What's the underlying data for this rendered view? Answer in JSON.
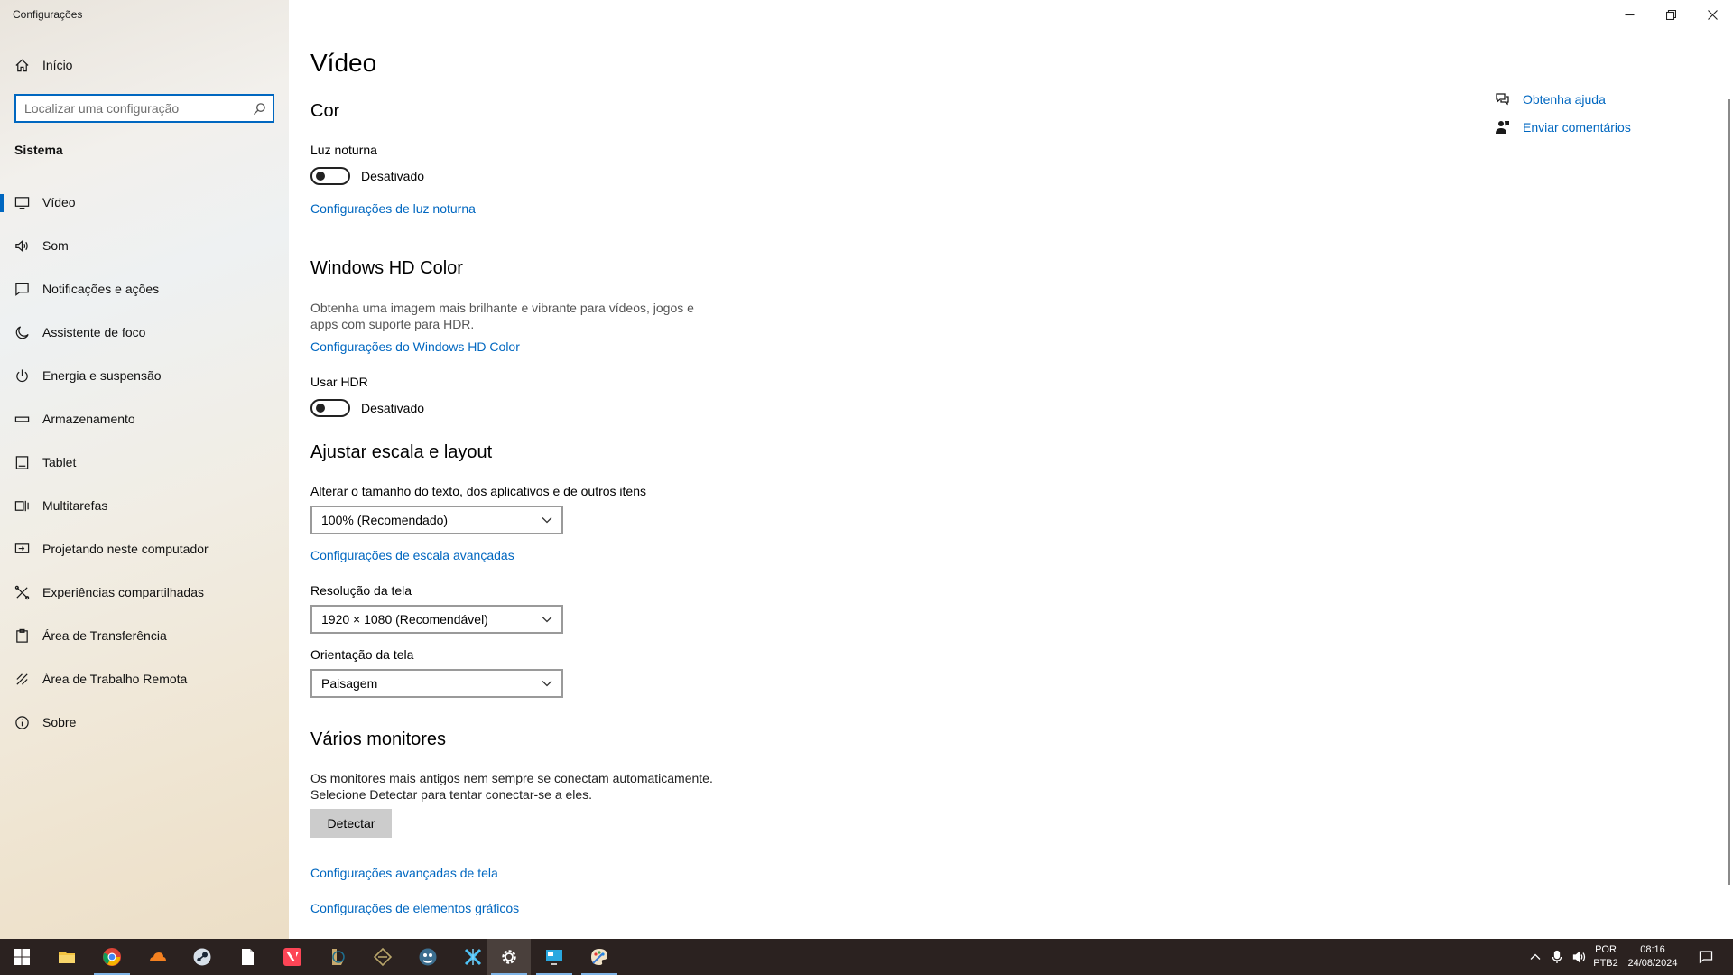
{
  "window": {
    "title": "Configurações",
    "controls": {
      "minimize": "minimize-icon",
      "restore": "restore-icon",
      "close": "close-icon"
    }
  },
  "sidebar": {
    "home_label": "Início",
    "search_placeholder": "Localizar uma configuração",
    "section_label": "Sistema",
    "items": [
      {
        "label": "Vídeo",
        "icon": "monitor-icon",
        "active": true
      },
      {
        "label": "Som",
        "icon": "speaker-icon"
      },
      {
        "label": "Notificações e ações",
        "icon": "notification-icon"
      },
      {
        "label": "Assistente de foco",
        "icon": "moon-icon"
      },
      {
        "label": "Energia e suspensão",
        "icon": "power-icon"
      },
      {
        "label": "Armazenamento",
        "icon": "storage-icon"
      },
      {
        "label": "Tablet",
        "icon": "tablet-icon"
      },
      {
        "label": "Multitarefas",
        "icon": "multitask-icon"
      },
      {
        "label": "Projetando neste computador",
        "icon": "project-icon"
      },
      {
        "label": "Experiências compartilhadas",
        "icon": "shared-icon"
      },
      {
        "label": "Área de Transferência",
        "icon": "clipboard-icon"
      },
      {
        "label": "Área de Trabalho Remota",
        "icon": "remote-icon"
      },
      {
        "label": "Sobre",
        "icon": "info-icon"
      }
    ]
  },
  "main": {
    "title": "Vídeo",
    "color": {
      "heading": "Cor",
      "night_light_label": "Luz noturna",
      "night_light_state": "Desativado",
      "night_light_link": "Configurações de luz noturna"
    },
    "hdr": {
      "heading": "Windows HD Color",
      "description_line1": "Obtenha uma imagem mais brilhante e vibrante para vídeos, jogos e",
      "description_line2": "apps com suporte para HDR.",
      "settings_link": "Configurações do Windows HD Color",
      "use_hdr_label": "Usar HDR",
      "use_hdr_state": "Desativado"
    },
    "scale": {
      "heading": "Ajustar escala e layout",
      "size_label": "Alterar o tamanho do texto, dos aplicativos e de outros itens",
      "size_value": "100% (Recomendado)",
      "advanced_link": "Configurações de escala avançadas",
      "resolution_label": "Resolução da tela",
      "resolution_value": "1920 × 1080 (Recomendável)",
      "orientation_label": "Orientação da tela",
      "orientation_value": "Paisagem"
    },
    "monitors": {
      "heading": "Vários monitores",
      "description_line1": "Os monitores mais antigos nem sempre se conectam automaticamente.",
      "description_line2": "Selecione Detectar para tentar conectar-se a eles.",
      "detect_button": "Detectar",
      "advanced_display_link": "Configurações avançadas de tela",
      "graphics_link": "Configurações de elementos gráficos"
    },
    "help": {
      "get_help": "Obtenha ajuda",
      "feedback": "Enviar comentários"
    }
  },
  "taskbar": {
    "apps": [
      "windows-start-icon",
      "file-explorer-icon",
      "chrome-icon",
      "cloudflare-icon",
      "steam-icon",
      "notepad-icon",
      "valorant-icon",
      "league-icon",
      "riot-icon",
      "game-icon",
      "x-app-icon",
      "settings-icon",
      "remote-desktop-icon",
      "paint-icon"
    ],
    "tray": {
      "language_line1": "POR",
      "language_line2": "PTB2",
      "time": "08:16",
      "date": "24/08/2024"
    },
    "colors": {
      "background": "#2b2220",
      "accent": "#0067c0"
    }
  }
}
